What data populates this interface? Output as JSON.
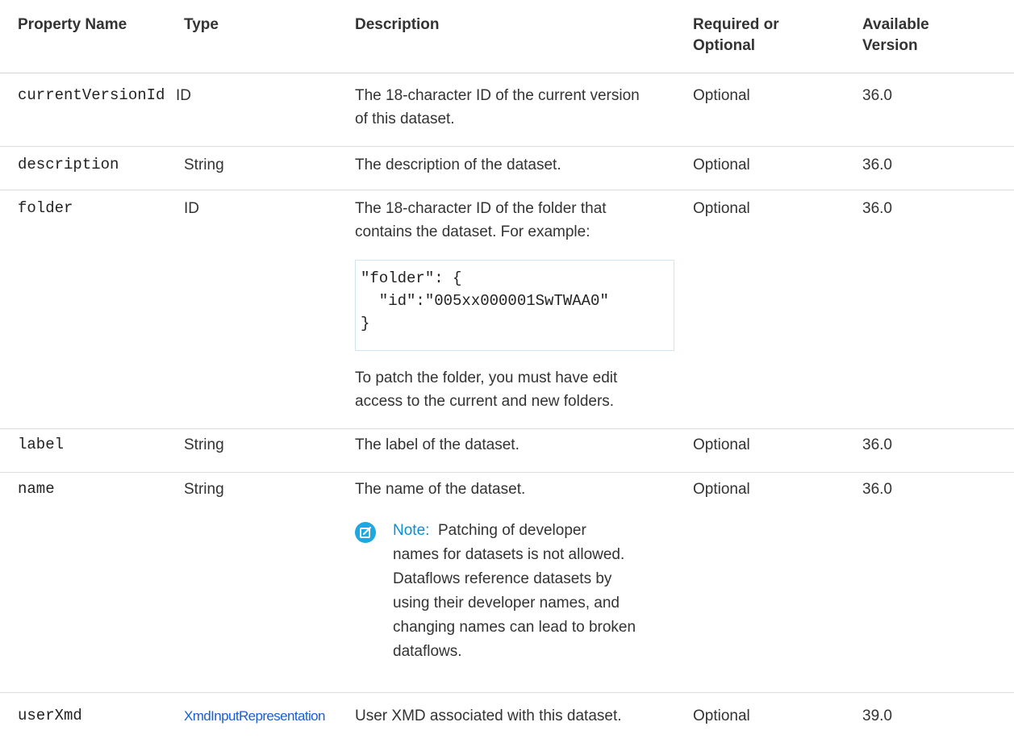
{
  "headers": {
    "property_name": "Property Name",
    "type": "Type",
    "description": "Description",
    "required_line1": "Required or",
    "required_line2": "Optional",
    "version_line1": "Available",
    "version_line2": "Version"
  },
  "rows": [
    {
      "name": "currentVersionId",
      "type": "ID",
      "desc_line1": "The 18-character ID of the current version",
      "desc_line2": "of this dataset.",
      "required": "Optional",
      "version": "36.0"
    },
    {
      "name": "description",
      "type": "String",
      "desc_line1": "The description of the dataset.",
      "required": "Optional",
      "version": "36.0"
    },
    {
      "name": "folder",
      "type": "ID",
      "desc_line1": "The 18-character ID of the folder that",
      "desc_line2": "contains the dataset. For example:",
      "code_line1": "\"folder\": {",
      "code_line2": "  \"id\":\"005xx000001SwTWAA0\"",
      "code_line3": "}",
      "after_line1": "To patch the folder, you must have edit",
      "after_line2": "access to the current and new folders.",
      "required": "Optional",
      "version": "36.0"
    },
    {
      "name": "label",
      "type": "String",
      "desc_line1": "The label of the dataset.",
      "required": "Optional",
      "version": "36.0"
    },
    {
      "name": "name",
      "type": "String",
      "desc_line1": "The name of the dataset.",
      "note_label": "Note:",
      "note_line1": "Patching of developer",
      "note_line2": "names for datasets is not allowed.",
      "note_line3": "Dataflows reference datasets by",
      "note_line4": "using their developer names, and",
      "note_line5": "changing names can lead to broken",
      "note_line6": "dataflows.",
      "note_icon": "edit-note-icon",
      "required": "Optional",
      "version": "36.0"
    },
    {
      "name": "userXmd",
      "type": "XmdInputRepresentation",
      "desc_line1": "User XMD associated with this dataset.",
      "required": "Optional",
      "version": "39.0"
    }
  ],
  "colors": {
    "link": "#1a5fd0",
    "note_icon": "#1ea8e0",
    "note_label": "#0a8fd0"
  }
}
